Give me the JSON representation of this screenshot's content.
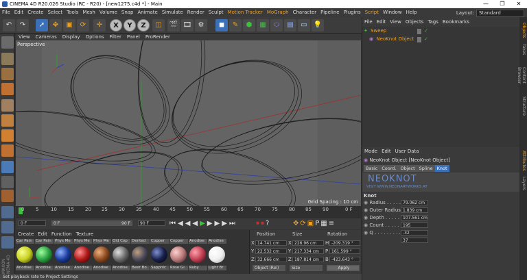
{
  "title": "CINEMA 4D R20.026 Studio (RC - R20) - [new1275.c4d *] - Main",
  "window_controls": {
    "minimize": "—",
    "maximize": "❐",
    "close": "✕"
  },
  "menus": [
    "File",
    "Edit",
    "Create",
    "Select",
    "Tools",
    "Mesh",
    "Volume",
    "Snap",
    "Animate",
    "Simulate",
    "Render",
    "Sculpt",
    "Motion Tracker",
    "MoGraph",
    "Character",
    "Pipeline",
    "Plugins",
    "Script",
    "Window",
    "Help"
  ],
  "layout": {
    "label": "Layout:",
    "value": "Standard"
  },
  "toolbar": {
    "x": "X",
    "y": "Y",
    "z": "Z"
  },
  "viewport": {
    "menus": [
      "View",
      "Cameras",
      "Display",
      "Options",
      "Filter",
      "Panel",
      "ProRender"
    ],
    "label": "Perspective",
    "grid_spacing": "Grid Spacing : 10 cm"
  },
  "timeline": {
    "ticks": [
      "0",
      "5",
      "10",
      "15",
      "20",
      "25",
      "30",
      "35",
      "40",
      "45",
      "50",
      "55",
      "60",
      "65",
      "70",
      "75",
      "80",
      "85",
      "90"
    ],
    "end_label": "0 F",
    "start_field": "0 F",
    "current_field": "0 F",
    "end_field": "90 F",
    "max_field": "90 F"
  },
  "materials": {
    "menus": [
      "Create",
      "Edit",
      "Function",
      "Texture"
    ],
    "items": [
      {
        "label": "Car Pain",
        "color": "#c8d020"
      },
      {
        "label": "Car Pain",
        "color": "#2aa040"
      },
      {
        "label": "Phys Me",
        "color": "#1a3c9a"
      },
      {
        "label": "Phys Me",
        "color": "#b01818"
      },
      {
        "label": "Phys Me",
        "color": "#8a4a20"
      },
      {
        "label": "Old Cop",
        "color": "#6a6a6a"
      },
      {
        "label": "Dented",
        "color": "#4a4a5a"
      },
      {
        "label": "Copper",
        "color": "#18204a"
      },
      {
        "label": "Copper",
        "color": "#b87a7a"
      },
      {
        "label": "Anodise",
        "color": "#c04050"
      },
      {
        "label": "Anodise",
        "color": "#ffffff"
      }
    ],
    "items_row2": [
      "Anodise",
      "Anodise",
      "Anodise",
      "Anodise",
      "Anodise",
      "Anodise",
      "Beer Bo",
      "Sapphic",
      "Rose Gi",
      "Ruby",
      "Light Br"
    ]
  },
  "coordinates": {
    "headers": [
      "Position",
      "Size",
      "Rotation"
    ],
    "rows": [
      {
        "axis": "X",
        "pos": "14.741 cm",
        "size_axis": "X",
        "size": "226.96 cm",
        "rot_axis": "H",
        "rot": "-209.319 °"
      },
      {
        "axis": "Y",
        "pos": "22.532 cm",
        "size_axis": "Y",
        "size": "217.334 cm",
        "rot_axis": "P",
        "rot": "161.599 °"
      },
      {
        "axis": "Z",
        "pos": "32.666 cm",
        "size_axis": "Z",
        "size": "187.814 cm",
        "rot_axis": "B",
        "rot": "-423.643 °"
      }
    ],
    "mode": "Object (Rel)",
    "size_mode": "Size",
    "apply": "Apply"
  },
  "objects": {
    "menus": [
      "File",
      "Edit",
      "View",
      "Objects",
      "Tags",
      "Bookmarks"
    ],
    "items": [
      "Sweep",
      "NeoKnot Object"
    ]
  },
  "attributes": {
    "menus": [
      "Mode",
      "Edit",
      "User Data"
    ],
    "object_title": "NeoKnot Object [NeoKnot Object]",
    "tabs": [
      "Basic",
      "Coord.",
      "Object",
      "Spline",
      "Knot"
    ],
    "banner": "NEOKNOT",
    "banner_url": "VISIT WWW.NEONARTWORKS.AT",
    "section": "Knot",
    "params": [
      {
        "label": "Radius . . . . . . .",
        "value": "79.062 cm"
      },
      {
        "label": "Outer Radius",
        "value": "1.839 cm"
      },
      {
        "label": "Depth . . . . . . .",
        "value": "107.561 cm"
      },
      {
        "label": "Count . . . . . . .",
        "value": "195"
      },
      {
        "label": "Q . . . . . . . . . .",
        "value": "-32"
      },
      {
        "label": "",
        "value": "37"
      }
    ]
  },
  "side_tabs": [
    "Objects",
    "Takes",
    "Content Browser",
    "Structure",
    "Attributes",
    "Layers"
  ],
  "status": "Set playback rate to Project Settings"
}
